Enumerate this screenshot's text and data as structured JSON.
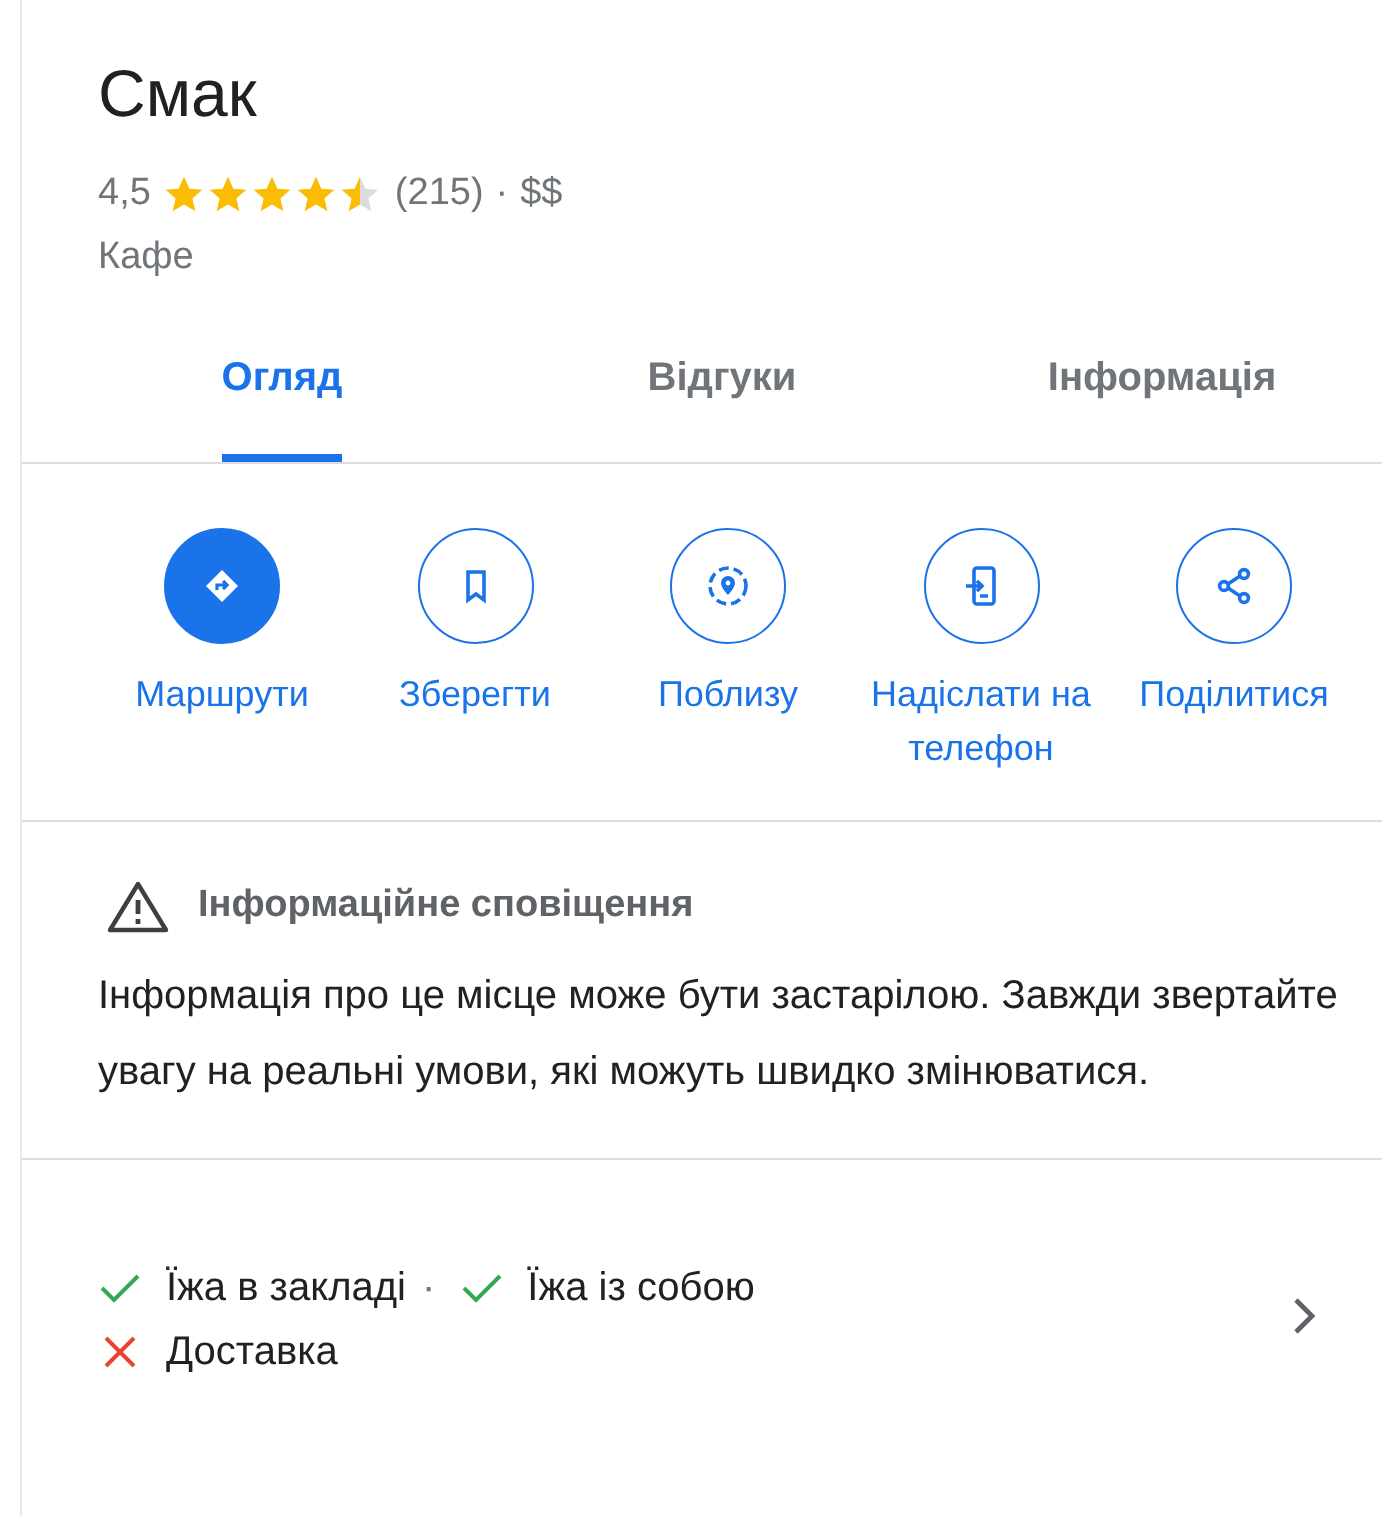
{
  "place": {
    "name": "Смак",
    "rating": "4,5",
    "stars": 4.5,
    "reviews": "(215)",
    "dot": "·",
    "price": "$$",
    "category": "Кафе"
  },
  "tabs": [
    {
      "label": "Огляд",
      "selected": true
    },
    {
      "label": "Відгуки",
      "selected": false
    },
    {
      "label": "Інформація",
      "selected": false
    }
  ],
  "actions": [
    {
      "kind": "directions",
      "label": "Маршрути",
      "primary": true
    },
    {
      "kind": "save",
      "label": "Зберегти",
      "primary": false
    },
    {
      "kind": "nearby",
      "label": "Поблизу",
      "primary": false
    },
    {
      "kind": "phone",
      "label": "Надіслати на телефон",
      "primary": false
    },
    {
      "kind": "share",
      "label": "Поділитися",
      "primary": false
    }
  ],
  "alert": {
    "title": "Інформаційне сповіщення",
    "text": "Інформація про це місце може бути застарілою. Завжди звертайте увагу на реальні умови, які можуть швидко змінюватися."
  },
  "services": {
    "separator": "·",
    "rows": [
      [
        {
          "label": "Їжа в закладі",
          "available": true
        },
        {
          "label": "Їжа із собою",
          "available": true
        }
      ],
      [
        {
          "label": "Доставка",
          "available": false
        }
      ]
    ]
  }
}
